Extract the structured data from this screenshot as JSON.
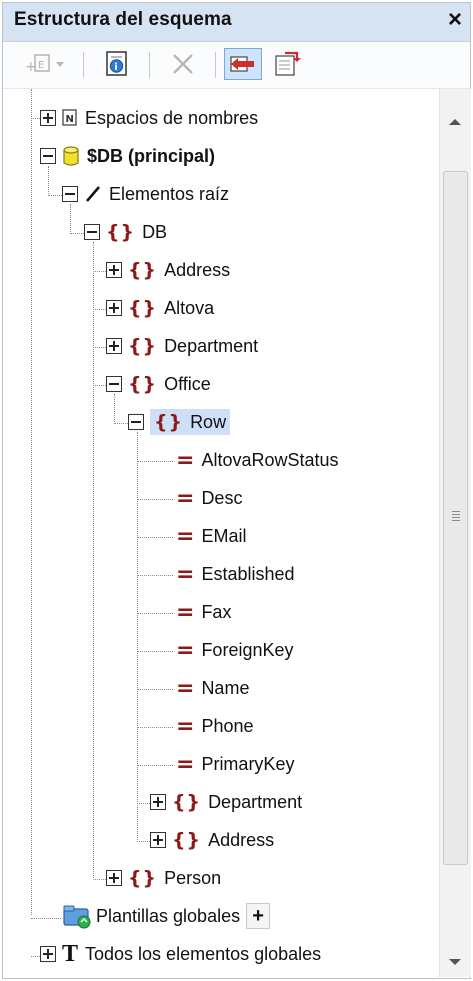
{
  "window": {
    "title": "Estructura del esquema",
    "close_label": "×"
  },
  "toolbar": {
    "buttons": [
      {
        "icon": "add-element-icon",
        "enabled": false,
        "has_dropdown": true
      },
      {
        "icon": "schema-info-icon",
        "enabled": true
      },
      {
        "icon": "delete-icon",
        "enabled": false
      },
      {
        "icon": "show-in-design-icon",
        "enabled": true,
        "pressed": true
      },
      {
        "icon": "schema-sources-icon",
        "enabled": true
      }
    ]
  },
  "tree": {
    "namespaces": "Espacios de nombres",
    "db_principal": "$DB (principal)",
    "root_elements": "Elementos raíz",
    "db": "DB",
    "address": "Address",
    "altova": "Altova",
    "department": "Department",
    "office": "Office",
    "row": "Row",
    "attributes": [
      "AltovaRowStatus",
      "Desc",
      "EMail",
      "Established",
      "Fax",
      "ForeignKey",
      "Name",
      "Phone",
      "PrimaryKey"
    ],
    "row_department": "Department",
    "row_address": "Address",
    "person": "Person",
    "global_templates": "Plantillas globales",
    "global_templates_add": "+",
    "all_globals": "Todos los elementos globales"
  },
  "colors": {
    "title_bg": "#d6e3f3",
    "element_icon": "#8b1a1a",
    "selection": "#cde0f7",
    "db_icon": "#f2e12a",
    "pressed_button_bg": "#cfe3fb"
  }
}
